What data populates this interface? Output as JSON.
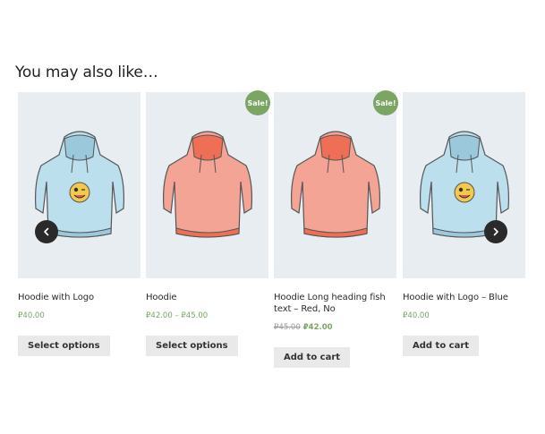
{
  "section": {
    "title": "You may also like…"
  },
  "carousel": {
    "prev_icon": "chevron-left-icon",
    "next_icon": "chevron-right-icon"
  },
  "products": [
    {
      "name": "Hoodie with Logo",
      "price": "₽40.00",
      "button": "Select options",
      "color": "blue",
      "has_logo": true,
      "sale": false
    },
    {
      "name": "Hoodie",
      "price": "₽42.00 – ₽45.00",
      "button": "Select options",
      "color": "red",
      "has_logo": false,
      "sale": true,
      "sale_label": "Sale!"
    },
    {
      "name": "Hoodie Long heading fish text – Red, No",
      "old_price": "₽45.00",
      "price": "₽42.00",
      "button": "Add to cart",
      "color": "red",
      "has_logo": false,
      "sale": true,
      "sale_label": "Sale!"
    },
    {
      "name": "Hoodie with Logo – Blue",
      "price": "₽40.00",
      "button": "Add to cart",
      "color": "blue",
      "has_logo": true,
      "sale": false
    }
  ],
  "colors": {
    "hoodie_blue": "#bcdfee",
    "hoodie_blue_dark": "#9cc8dc",
    "hoodie_red": "#f3a494",
    "hoodie_red_dark": "#ee6f55",
    "accent_green": "#7aa562",
    "thumb_bg": "#e8edf1"
  }
}
